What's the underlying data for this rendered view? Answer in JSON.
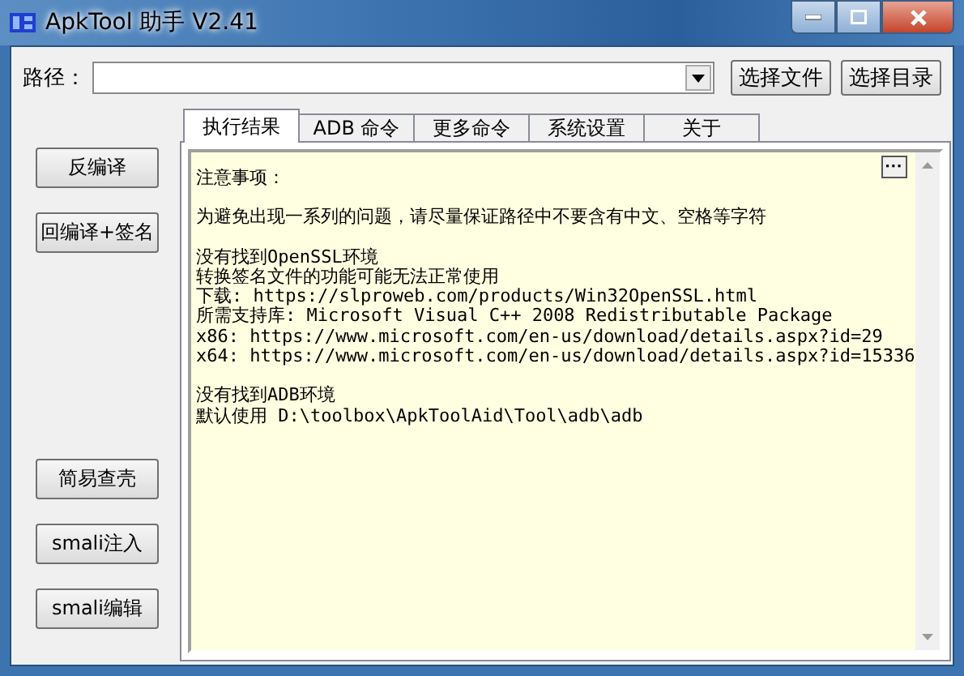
{
  "window": {
    "title": "ApkTool 助手 V2.41"
  },
  "path": {
    "label": "路径：",
    "buttons": [
      "选择文件",
      "选择目录"
    ]
  },
  "tabs": [
    {
      "label": "执行结果",
      "selected": true
    },
    {
      "label": "ADB 命令",
      "selected": false
    },
    {
      "label": "更多命令",
      "selected": false
    },
    {
      "label": "系统设置",
      "selected": false
    },
    {
      "label": "关于",
      "selected": false
    }
  ],
  "side_buttons": {
    "top": [
      "反编译",
      "回编译+签名"
    ],
    "bottom": [
      "简易查壳",
      "smali注入",
      "smali编辑"
    ]
  },
  "log": {
    "more_button": "···",
    "paragraphs": [
      [
        "注意事项："
      ],
      [
        "为避免出现一系列的问题，请尽量保证路径中不要含有中文、空格等字符"
      ],
      [
        "没有找到OpenSSL环境",
        "转换签名文件的功能可能无法正常使用",
        "下载: https://slproweb.com/products/Win32OpenSSL.html",
        "所需支持库: Microsoft Visual C++ 2008 Redistributable Package",
        "x86: https://www.microsoft.com/en-us/download/details.aspx?id=29",
        "x64: https://www.microsoft.com/en-us/download/details.aspx?id=15336"
      ],
      [
        "没有找到ADB环境",
        "默认使用 D:\\toolbox\\ApkToolAid\\Tool\\adb\\adb"
      ]
    ]
  }
}
